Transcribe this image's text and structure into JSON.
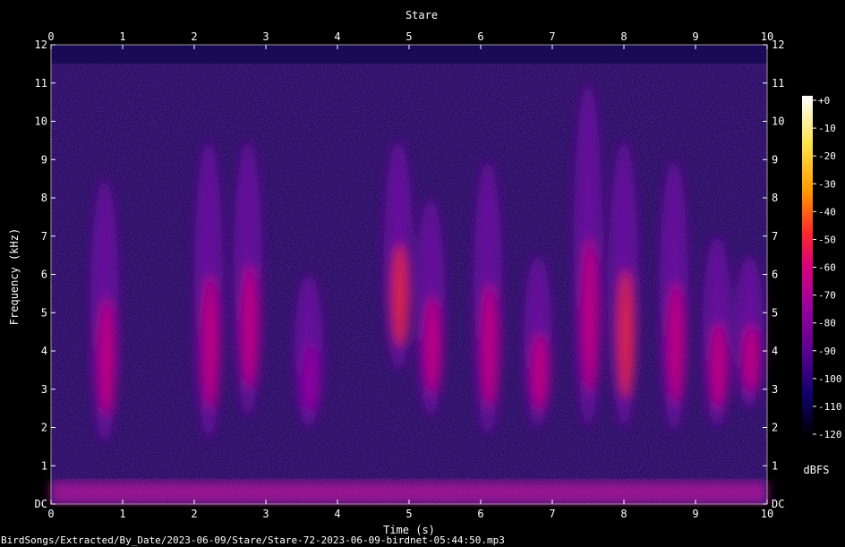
{
  "chart_data": {
    "type": "heatmap",
    "title": "Stare",
    "xlabel": "Time (s)",
    "ylabel": "Frequency (kHz)",
    "xlim": [
      0,
      10
    ],
    "ylim": [
      0,
      12
    ],
    "x_ticks": [
      "0",
      "1",
      "2",
      "3",
      "4",
      "5",
      "6",
      "7",
      "8",
      "9",
      "10"
    ],
    "y_ticks": [
      "DC",
      "1",
      "2",
      "3",
      "4",
      "5",
      "6",
      "7",
      "8",
      "9",
      "10",
      "11",
      "12"
    ],
    "colorbar": {
      "label": "dBFS",
      "range": [
        -120,
        0
      ],
      "ticks": [
        "+0",
        "-10",
        "-20",
        "-30",
        "-40",
        "-50",
        "-60",
        "-70",
        "-80",
        "-90",
        "-100",
        "-110",
        "-120"
      ],
      "colors": [
        "#000000",
        "#10006a",
        "#5a0090",
        "#9a00a0",
        "#d8007a",
        "#ff2a2a",
        "#ff9a00",
        "#ffe24a",
        "#ffffff"
      ]
    },
    "footer": "BirdSongs/Extracted/By_Date/2023-06-09/Stare/Stare-72-2023-06-09-birdnet-05:44:50.mp3",
    "bursts": [
      {
        "t": 0.75,
        "f_low": 1.6,
        "f_high": 8.5,
        "peak_db": -58
      },
      {
        "t": 2.2,
        "f_low": 1.7,
        "f_high": 9.5,
        "peak_db": -58
      },
      {
        "t": 2.75,
        "f_low": 2.3,
        "f_high": 9.5,
        "peak_db": -56
      },
      {
        "t": 3.6,
        "f_low": 2.0,
        "f_high": 6.0,
        "peak_db": -70
      },
      {
        "t": 4.85,
        "f_low": 3.5,
        "f_high": 9.5,
        "peak_db": -48
      },
      {
        "t": 5.3,
        "f_low": 2.3,
        "f_high": 8.0,
        "peak_db": -60
      },
      {
        "t": 6.1,
        "f_low": 1.8,
        "f_high": 9.0,
        "peak_db": -58
      },
      {
        "t": 6.8,
        "f_low": 2.0,
        "f_high": 6.5,
        "peak_db": -66
      },
      {
        "t": 7.5,
        "f_low": 2.0,
        "f_high": 11.0,
        "peak_db": -54
      },
      {
        "t": 8.0,
        "f_low": 2.0,
        "f_high": 9.5,
        "peak_db": -50
      },
      {
        "t": 8.7,
        "f_low": 1.9,
        "f_high": 9.0,
        "peak_db": -58
      },
      {
        "t": 9.3,
        "f_low": 2.0,
        "f_high": 7.0,
        "peak_db": -62
      },
      {
        "t": 9.75,
        "f_low": 2.5,
        "f_high": 6.5,
        "peak_db": -62
      }
    ]
  }
}
